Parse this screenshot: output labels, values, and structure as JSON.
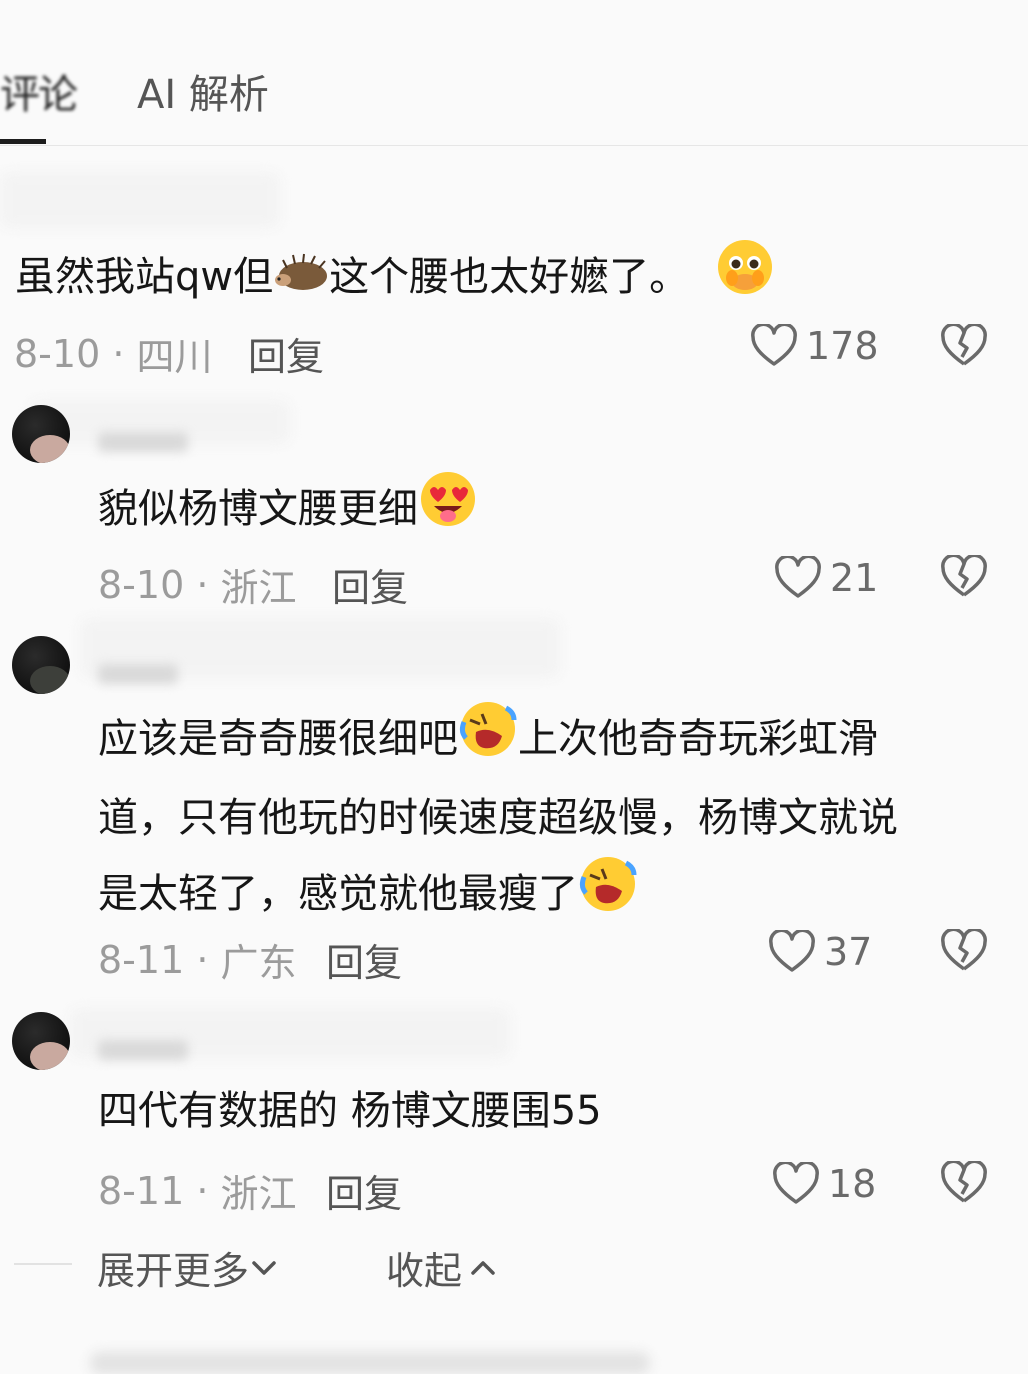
{
  "tabs": {
    "previous_tab_partial": "评论",
    "ai_tab": "AI 解析"
  },
  "comments": [
    {
      "text_before": "虽然我站qw但",
      "text_after": "这个腰也太好嬷了。",
      "emoji_inline": "hedgehog",
      "emoji_end": "pleading-face",
      "date": "8-10",
      "location": "四川",
      "reply": "回复",
      "likes": "178"
    },
    {
      "text": "貌似杨博文腰更细",
      "emoji_end": "heart-eyes-tongue",
      "date": "8-10",
      "location": "浙江",
      "reply": "回复",
      "likes": "21"
    },
    {
      "line1_before": "应该是奇奇腰很细吧",
      "line1_after": "上次他奇奇玩彩虹滑",
      "line2": "道，只有他玩的时候速度超级慢，杨博文就说",
      "line3": "是太轻了，感觉就他最瘦了",
      "emoji": "rolling-laughing",
      "date": "8-11",
      "location": "广东",
      "reply": "回复",
      "likes": "37"
    },
    {
      "text": "四代有数据的 杨博文腰围55",
      "date": "8-11",
      "location": "浙江",
      "reply": "回复",
      "likes": "18"
    }
  ],
  "footer": {
    "expand": "展开更多",
    "collapse": "收起"
  },
  "colors": {
    "text": "#161616",
    "meta": "#9b9b9b",
    "icon": "#6a6a6a"
  }
}
